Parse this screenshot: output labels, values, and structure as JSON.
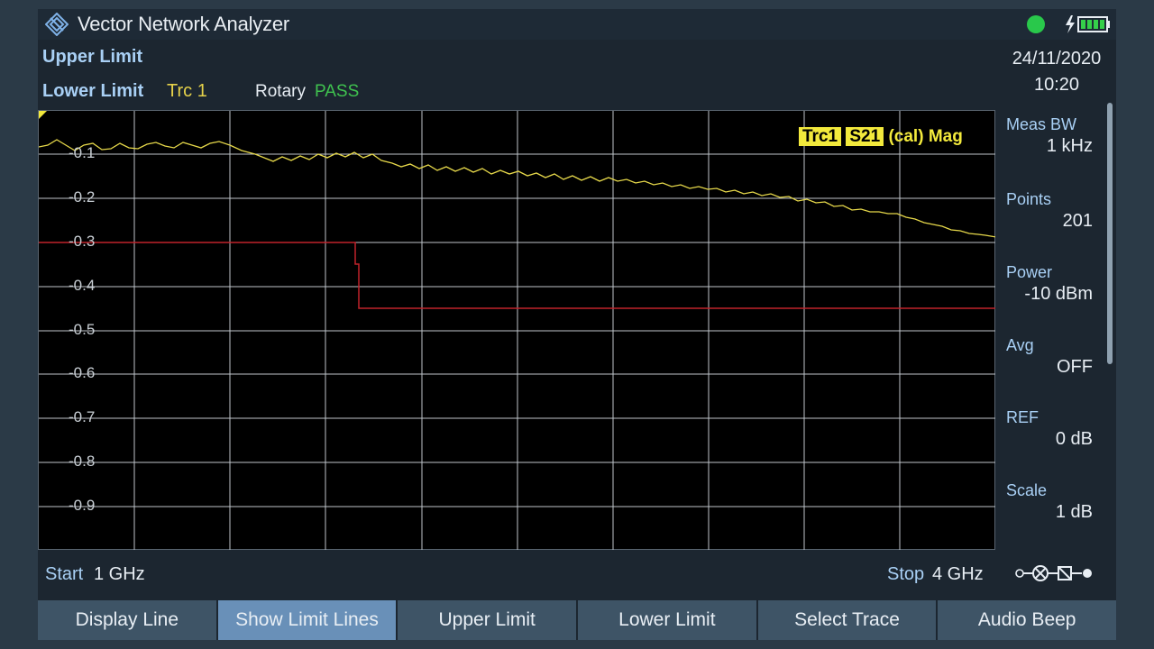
{
  "titlebar": {
    "title": "Vector Network Analyzer",
    "icon": "rohde-diamond-icon",
    "status_led_color": "#29c84b"
  },
  "header": {
    "upper_limit": "Upper Limit",
    "lower_limit": "Lower Limit",
    "trace": "Trc 1",
    "rotary": "Rotary",
    "pass": "PASS"
  },
  "datetime": {
    "date": "24/11/2020",
    "time": "10:20"
  },
  "sidebar": {
    "items": [
      {
        "label": "Meas BW",
        "value": "1 kHz"
      },
      {
        "label": "Points",
        "value": "201"
      },
      {
        "label": "Power",
        "value": "-10 dBm"
      },
      {
        "label": "Avg",
        "value": "OFF"
      },
      {
        "label": "REF",
        "value": "0 dB"
      },
      {
        "label": "Scale",
        "value": "1 dB"
      }
    ]
  },
  "plot": {
    "trace_label": {
      "trc": "Trc1",
      "param": "S21",
      "rest": "(cal)  Mag"
    },
    "yticks": [
      "-0.1",
      "-0.2",
      "-0.3",
      "-0.4",
      "-0.5",
      "-0.6",
      "-0.7",
      "-0.8",
      "-0.9"
    ],
    "trace_color": "#e6d84a",
    "limit_color": "#c0232a"
  },
  "footer": {
    "start_label": "Start",
    "start_value": "1 GHz",
    "stop_label": "Stop",
    "stop_value": "4 GHz"
  },
  "softkeys": [
    {
      "label": "Display Line",
      "active": false
    },
    {
      "label": "Show Limit Lines",
      "active": true
    },
    {
      "label": "Upper Limit",
      "active": false
    },
    {
      "label": "Lower Limit",
      "active": false
    },
    {
      "label": "Select Trace",
      "active": false
    },
    {
      "label": "Audio Beep",
      "active": false
    }
  ]
}
